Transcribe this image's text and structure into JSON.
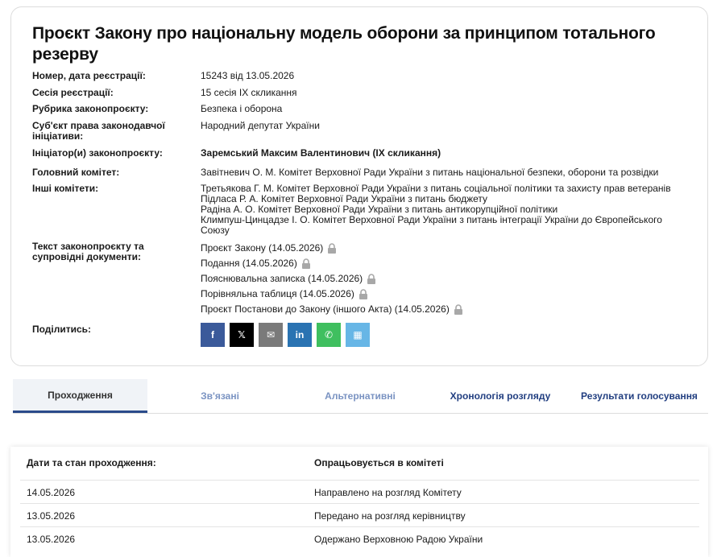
{
  "bill": {
    "title": "Проєкт Закону про національну модель оборони за принципом тотального резерву",
    "fields": {
      "reg_number": {
        "label": "Номер, дата реєстрації:",
        "value": "15243 від 13.05.2026"
      },
      "session": {
        "label": "Сесія реєстрації:",
        "value": "15 сесія IX скликання"
      },
      "rubric": {
        "label": "Рубрика законопроєкту:",
        "value": "Безпека і оборона"
      },
      "subject_l1": "Суб'єкт права законодавчої",
      "subject_l2": "ініціативи:",
      "subject_value": "Народний депутат України",
      "initiator": {
        "label": "Ініціатор(и) законопроєкту:",
        "value": "Заремський Максим Валентинович (IX скликання)"
      },
      "main_committee": {
        "label": "Головний комітет:",
        "value": "Завітневич О. М. Комітет Верховної Ради України з питань національної безпеки, оборони та розвідки"
      },
      "other_committees_label": "Інші комітети:",
      "other_committees": [
        "Третьякова Г. М. Комітет Верховної Ради України з питань соціальної політики та захисту прав ветеранів",
        "Підласа Р. А. Комітет Верховної Ради України з питань бюджету",
        "Радіна А. О. Комітет Верховної Ради України з питань антикорупційної політики",
        "Климпуш-Цинцадзе І. О. Комітет Верховної Ради України з питань інтеграції України до Європейського",
        "Союзу"
      ],
      "docs_l1": "Текст законопроєкту та",
      "docs_l2": "супровідні документи:",
      "documents": [
        "Проєкт Закону (14.05.2026)",
        "Подання (14.05.2026)",
        "Пояснювальна записка (14.05.2026)",
        "Порівняльна таблиця (14.05.2026)",
        "Проєкт Постанови до Закону (іншого Акта) (14.05.2026)"
      ],
      "share_label": "Поділитись:"
    }
  },
  "share_buttons": [
    {
      "name": "facebook",
      "glyph": "f",
      "color": "#3b5a9a"
    },
    {
      "name": "x",
      "glyph": "𝕏",
      "color": "#000000"
    },
    {
      "name": "email",
      "glyph": "✉",
      "color": "#7a7a7a"
    },
    {
      "name": "linkedin",
      "glyph": "in",
      "color": "#2a73b2"
    },
    {
      "name": "whatsapp",
      "glyph": "✆",
      "color": "#3fbf5f"
    },
    {
      "name": "qr",
      "glyph": "▦",
      "color": "#67b6e6"
    }
  ],
  "tabs": [
    {
      "label": "Проходження",
      "state": "active"
    },
    {
      "label": "Зв'язані",
      "state": "muted"
    },
    {
      "label": "Альтернативні",
      "state": "muted"
    },
    {
      "label": "Хронологія розгляду",
      "state": "dark"
    },
    {
      "label": "Результати голосування",
      "state": "dark"
    }
  ],
  "passage": {
    "header_date": "Дати та стан проходження:",
    "header_status": "Опрацьовується в комітеті",
    "rows": [
      {
        "date": "14.05.2026",
        "status": "Направлено на розгляд Комітету"
      },
      {
        "date": "13.05.2026",
        "status": "Передано на розгляд керівництву"
      },
      {
        "date": "13.05.2026",
        "status": "Одержано Верховною Радою України"
      }
    ]
  }
}
